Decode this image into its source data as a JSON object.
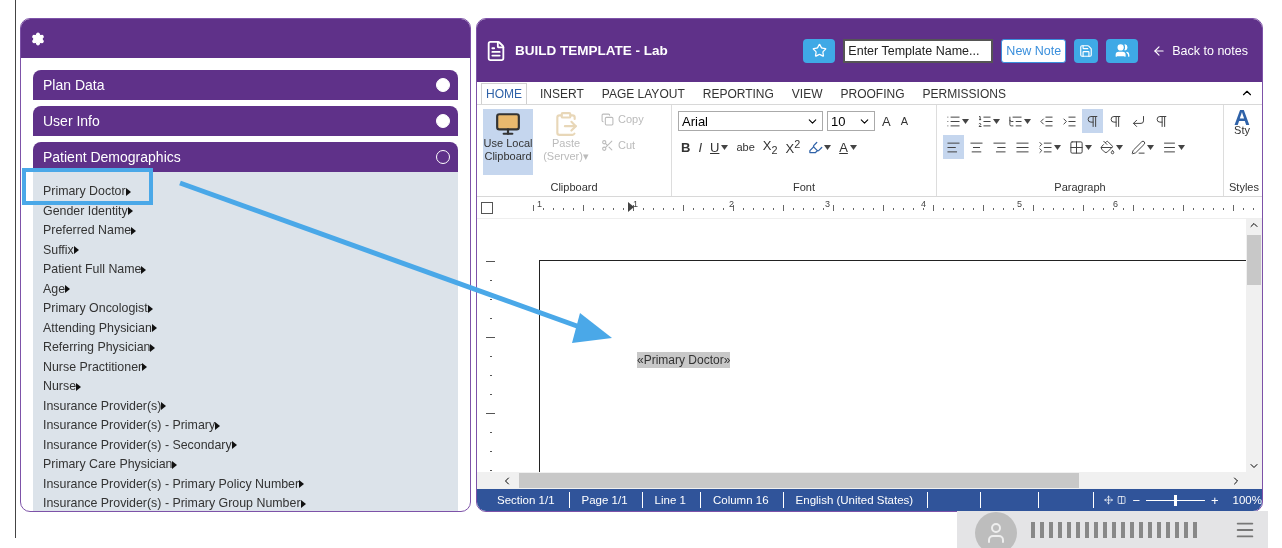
{
  "left_panel": {
    "sections": [
      {
        "title": "Plan Data",
        "expanded": false
      },
      {
        "title": "User Info",
        "expanded": false
      },
      {
        "title": "Patient Demographics",
        "expanded": true,
        "items": [
          "Primary Doctor",
          "Gender Identity",
          "Preferred Name",
          "Suffix",
          "Patient Full Name",
          "Age",
          "Primary Oncologist",
          "Attending Physician",
          "Referring Physician",
          "Nurse Practitioner",
          "Nurse",
          "Insurance Provider(s)",
          "Insurance Provider(s) - Primary",
          "Insurance Provider(s) - Secondary",
          "Primary Care Physician",
          "Insurance Provider(s) - Primary Policy Number",
          "Insurance Provider(s) - Primary Group Number"
        ]
      }
    ]
  },
  "editor": {
    "title": "BUILD TEMPLATE - Lab",
    "template_name": {
      "placeholder": "Enter Template Name..."
    },
    "new_note": "New Note",
    "back": "Back to notes",
    "tabs": [
      {
        "label": "HOME",
        "selected": true
      },
      {
        "label": "INSERT",
        "selected": false
      },
      {
        "label": "PAGE LAYOUT",
        "selected": false
      },
      {
        "label": "REPORTING",
        "selected": false
      },
      {
        "label": "VIEW",
        "selected": false
      },
      {
        "label": "PROOFING",
        "selected": false
      },
      {
        "label": "PERMISSIONS",
        "selected": false
      }
    ],
    "clipboard": {
      "label": "Clipboard",
      "local": {
        "label": "Use Local Clipboard",
        "selected": true
      },
      "paste": {
        "label": "Paste (Server)▾",
        "disabled": true
      },
      "copy": {
        "label": "Copy",
        "disabled": true
      },
      "cut": {
        "label": "Cut",
        "disabled": true
      }
    },
    "font": {
      "label": "Font",
      "family": "Arial",
      "size": "10",
      "grow": "A",
      "shrink": "A",
      "styles": [
        {
          "label": "B",
          "kind": "bold",
          "dropdown": false
        },
        {
          "label": "I",
          "kind": "italic",
          "dropdown": false
        },
        {
          "label": "U",
          "kind": "underline",
          "dropdown": true
        },
        {
          "label": "abe",
          "kind": "strike",
          "dropdown": false
        },
        {
          "label": "X$_{2}$",
          "kind": "plain",
          "dropdown": false
        },
        {
          "label": "X$^{2}$",
          "kind": "plain",
          "dropdown": false
        }
      ],
      "color_label": "A"
    },
    "paragraph": {
      "label": "Paragraph",
      "row1": [
        {
          "kind": "bullets",
          "dropdown": true,
          "selected": false
        },
        {
          "kind": "numbering",
          "dropdown": true,
          "selected": false
        },
        {
          "kind": "multilevel",
          "dropdown": true,
          "selected": false
        },
        {
          "kind": "outdent",
          "dropdown": false,
          "selected": false
        },
        {
          "kind": "indent",
          "dropdown": false,
          "selected": false
        },
        {
          "kind": "ltr",
          "dropdown": false,
          "selected": true
        },
        {
          "kind": "rtl",
          "dropdown": false,
          "selected": false
        },
        {
          "kind": "break",
          "dropdown": false,
          "selected": false
        },
        {
          "kind": "marks",
          "dropdown": false,
          "selected": false
        }
      ],
      "row2": [
        {
          "kind": "left",
          "dropdown": false,
          "selected": true
        },
        {
          "kind": "center",
          "dropdown": false,
          "selected": false
        },
        {
          "kind": "right",
          "dropdown": false,
          "selected": false
        },
        {
          "kind": "justify",
          "dropdown": false,
          "selected": false
        },
        {
          "kind": "spacing",
          "dropdown": true,
          "selected": false
        },
        {
          "kind": "borders",
          "dropdown": true,
          "selected": false
        },
        {
          "kind": "shading",
          "dropdown": true,
          "selected": false
        },
        {
          "kind": "pen",
          "dropdown": true,
          "selected": false
        },
        {
          "kind": "lines",
          "dropdown": true,
          "selected": false
        }
      ]
    },
    "styles": {
      "preview": "A",
      "button": "Sty",
      "label": "Styles"
    },
    "ruler": [
      "1",
      "1",
      "2",
      "3",
      "4",
      "5",
      "6"
    ],
    "document": {
      "field": "«Primary Doctor»"
    },
    "status_bar": {
      "cells": [
        "Section 1/1",
        "Page 1/1",
        "Line 1",
        "Column 16",
        "English (United States)"
      ],
      "zoom": {
        "minus": "−",
        "plus": "+",
        "level": 0.5,
        "reading": "100%"
      }
    }
  }
}
